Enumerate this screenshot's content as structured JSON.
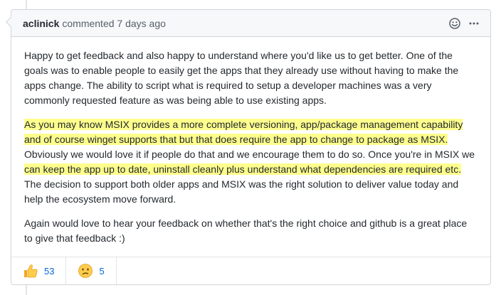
{
  "comment": {
    "author": "aclinick",
    "meta": "commented 7 days ago",
    "paragraphs": [
      [
        {
          "text": "Happy to get feedback and also happy to understand where you'd like us to get better. One of the goals was to enable people to easily get the apps that they already use without having to make the apps change. The ability to script what is required to setup a developer machines was a very commonly requested feature as was being able to use existing apps.",
          "highlight": false
        }
      ],
      [
        {
          "text": "As you may know MSIX provides a more complete versioning, app/package management capability and of course winget supports that but that does require the app to change to package as MSIX.",
          "highlight": true
        },
        {
          "text": " Obviously we would love it if people do that and we encourage them to do so. Once you're in MSIX we ",
          "highlight": false
        },
        {
          "text": "can keep the app up to date, uninstall cleanly plus understand what dependencies are required etc.",
          "highlight": true
        },
        {
          "text": " The decision to support both older apps and MSIX was the right solution to deliver value today and help the ecosystem move forward.",
          "highlight": false
        }
      ],
      [
        {
          "text": "Again would love to hear your feedback on whether that's the right choice and github is a great place to give that feedback :)",
          "highlight": false
        }
      ]
    ],
    "reactions": [
      {
        "icon": "thumbs-up-icon",
        "count": "53"
      },
      {
        "icon": "confused-face-icon",
        "count": "5"
      }
    ]
  },
  "colors": {
    "highlight": "#fefe8d",
    "link": "#0366d6",
    "header_bg": "#f6f8fa",
    "border": "#d1d5da"
  }
}
